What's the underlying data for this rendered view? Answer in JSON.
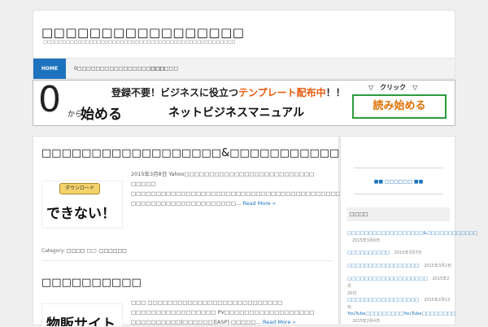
{
  "header": {
    "title": "□□□□□□□□□□□□□□□□□",
    "description": "□□□□□□□□□□□□□□□□□□□□□□□□□□□□□□□□□□□□□□□□□□□□□□□□□□"
  },
  "nav": {
    "items": [
      {
        "label": "HOME"
      },
      {
        "label": "0□□□□□□□□□□□□□□□□□□□"
      },
      {
        "label": "□□□□□□"
      }
    ]
  },
  "banner": {
    "zero": "0",
    "from": "から",
    "start": "始める",
    "tagline_part1": "登録不要！ビジネスに役立つ",
    "tagline_highlight": "テンプレート配布中",
    "tagline_part2": "！！",
    "manual": "ネットビジネスマニュアル",
    "click_label": "▽　クリック　▽",
    "read_button": "読み始める",
    "colors": {
      "highlight": "#e8580c",
      "button_border": "#2e9b3c",
      "button_text": "#e07000"
    }
  },
  "posts": [
    {
      "title": "□□□□□□□□□□□□□□□□□□&□□□□□□□□□□□□",
      "thumb_button": "ダウンロード",
      "thumb_text": "できない！",
      "excerpt": "2015年3月8日 Yahoo□□□□□□□□□□□□□□□□□□□□□□□□□□　□□□□□ □□□□□□□□□□□□□□□□□□□□□□□□□□□□□□□□□□□□□□□□□□□□□□□□ □□□□□□□□□□□□□□□□□□□□□...",
      "more": "Read More »",
      "meta_category_label": "Category:",
      "meta_category": "□□□□",
      "meta_tag_label": "□□:",
      "meta_tag": "□□□□□□"
    },
    {
      "title": "□□□□□□□□□□",
      "thumb_text": "物販サイト",
      "excerpt": "□□□ □□□□□□□□□□□□□□□□□□□□□□□□□□□ □□□□□□□□□□□□□□□□□ PV□□□□□□□□□□□□□□□□□□　□□□□□□□□□□[□□□□□□][ASP] □□□□□...",
      "more": "Read More »"
    }
  ],
  "sidebar": {
    "link": "■■ □□□□□□ ■■",
    "recent_heading": "□□□□",
    "recent": [
      {
        "title": "□□□□□□□□□□□□□□□□□□&□□□□□□□□□□□□",
        "date": "2015年3月8日"
      },
      {
        "title": "□□□□□□□□□□",
        "date": "2015年3月7日"
      },
      {
        "title": "□□□□□□□□□□□□□□□□□",
        "date": "2015年3月2日"
      },
      {
        "title": "□□□□□□□□□□□□□□□□□□□",
        "date": "2015年2月"
      },
      {
        "title": "20日",
        "date": ""
      },
      {
        "title": "□□□□□□□□□□□□□□□□□",
        "date": "2015年2月13日"
      },
      {
        "title": "YouTube□□□□□□□□□YouTube□□□□□□□□",
        "date": "2015年2月4日"
      }
    ]
  }
}
